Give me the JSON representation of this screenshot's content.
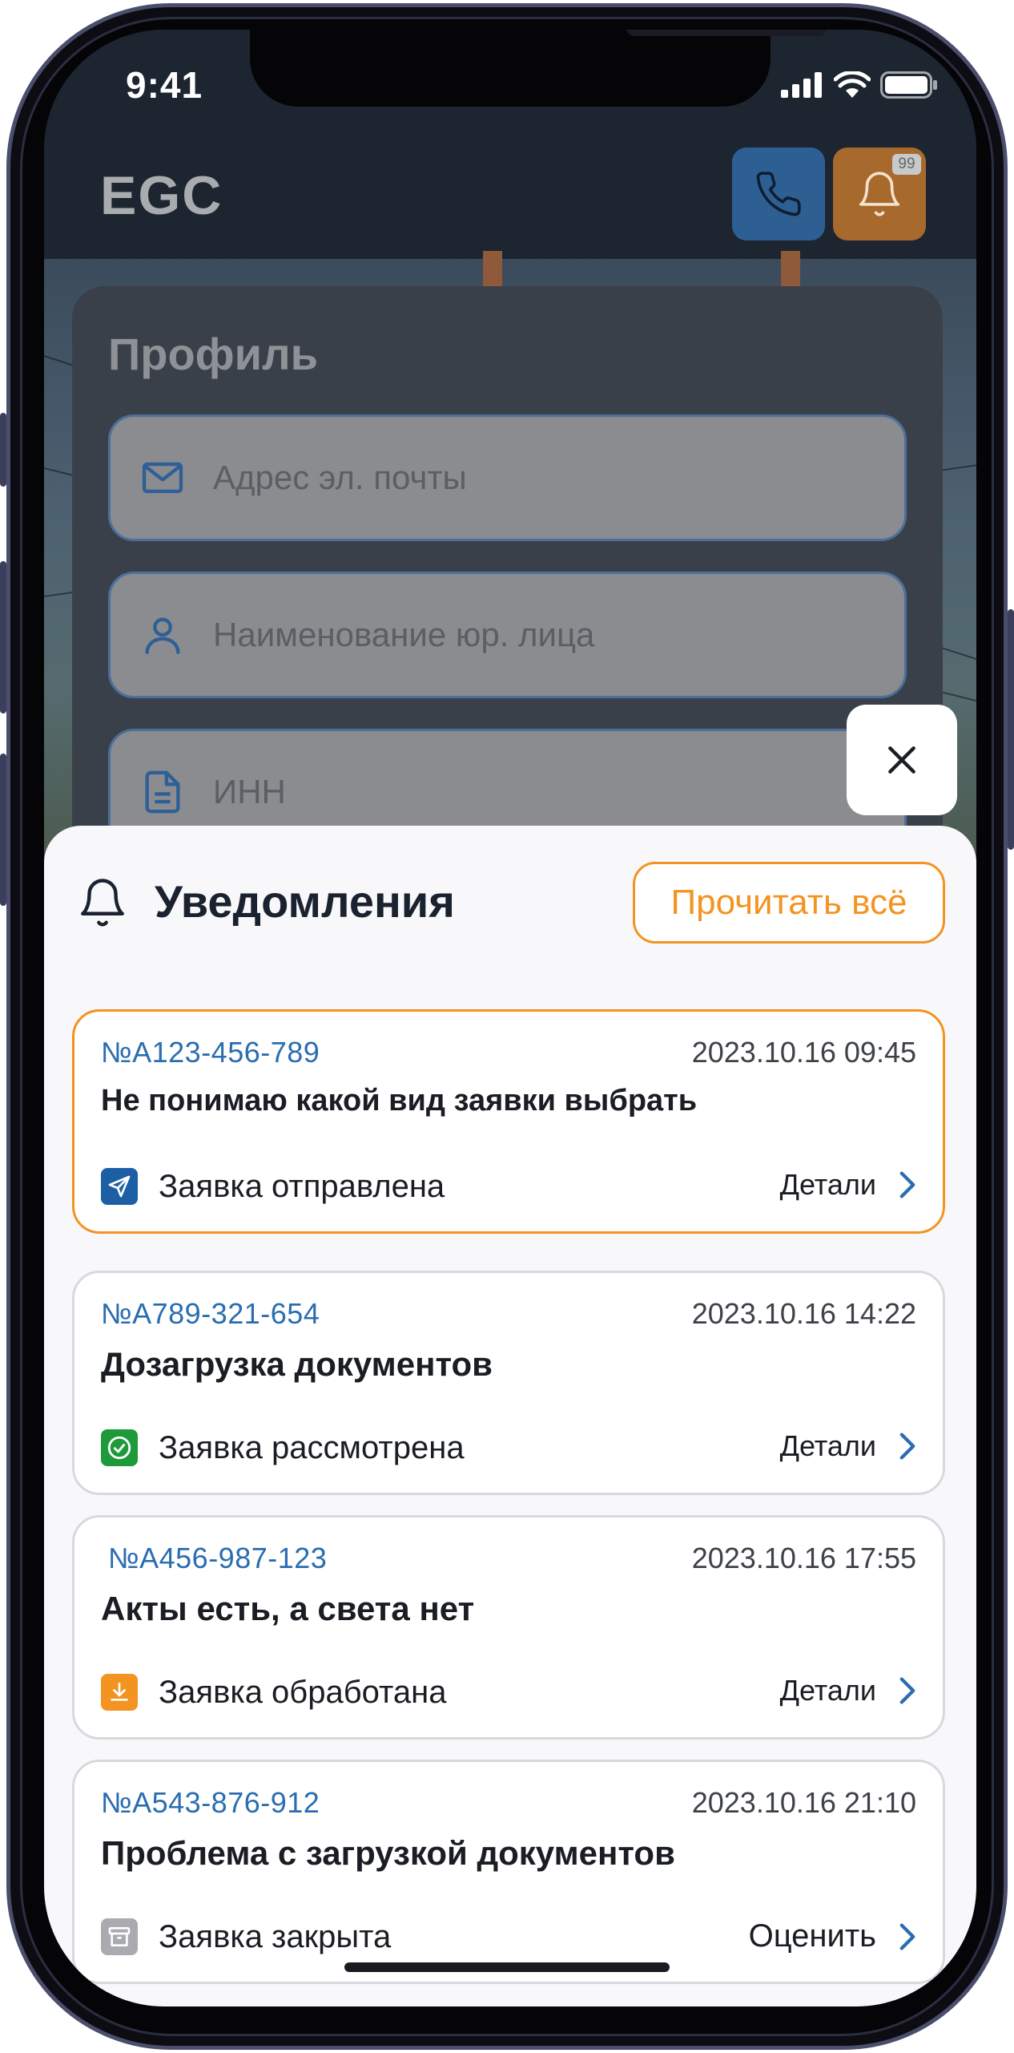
{
  "status_bar": {
    "time": "9:41"
  },
  "header": {
    "logo": "EGC",
    "notification_count": "99"
  },
  "profile": {
    "title": "Профиль",
    "fields": [
      {
        "icon": "mail-icon",
        "placeholder": "Адрес эл. почты"
      },
      {
        "icon": "user-icon",
        "placeholder": "Наименование юр. лица"
      },
      {
        "icon": "document-icon",
        "placeholder": "ИНН"
      }
    ]
  },
  "notifications": {
    "title": "Уведомления",
    "read_all_label": "Прочитать всё",
    "items": [
      {
        "number": "№A123-456-789",
        "date": "2023.10.16 09:45",
        "title": "Не понимаю какой вид заявки выбрать",
        "status": "Заявка отправлена",
        "status_icon": "send-icon",
        "status_color": "#1d5fa5",
        "action": "Детали",
        "active": true
      },
      {
        "number": "№A789-321-654",
        "date": "2023.10.16 14:22",
        "title": "Дозагрузка  документов",
        "status": "Заявка рассмотрена",
        "status_icon": "check-circle-icon",
        "status_color": "#1e9a3a",
        "action": "Детали",
        "active": false
      },
      {
        "number": "№A456-987-123",
        "date": "2023.10.16 17:55",
        "title": "Акты есть, а света нет",
        "status": "Заявка обработана",
        "status_icon": "download-icon",
        "status_color": "#f39321",
        "action": "Детали",
        "active": false
      },
      {
        "number": "№A543-876-912",
        "date": "2023.10.16 21:10",
        "title": "Проблема с загрузкой документов",
        "status": "Заявка закрыта",
        "status_icon": "archive-icon",
        "status_color": "#a9abb0",
        "action": "Оценить",
        "active": false
      }
    ]
  },
  "colors": {
    "accent": "#f39321",
    "link": "#2a6db0"
  }
}
